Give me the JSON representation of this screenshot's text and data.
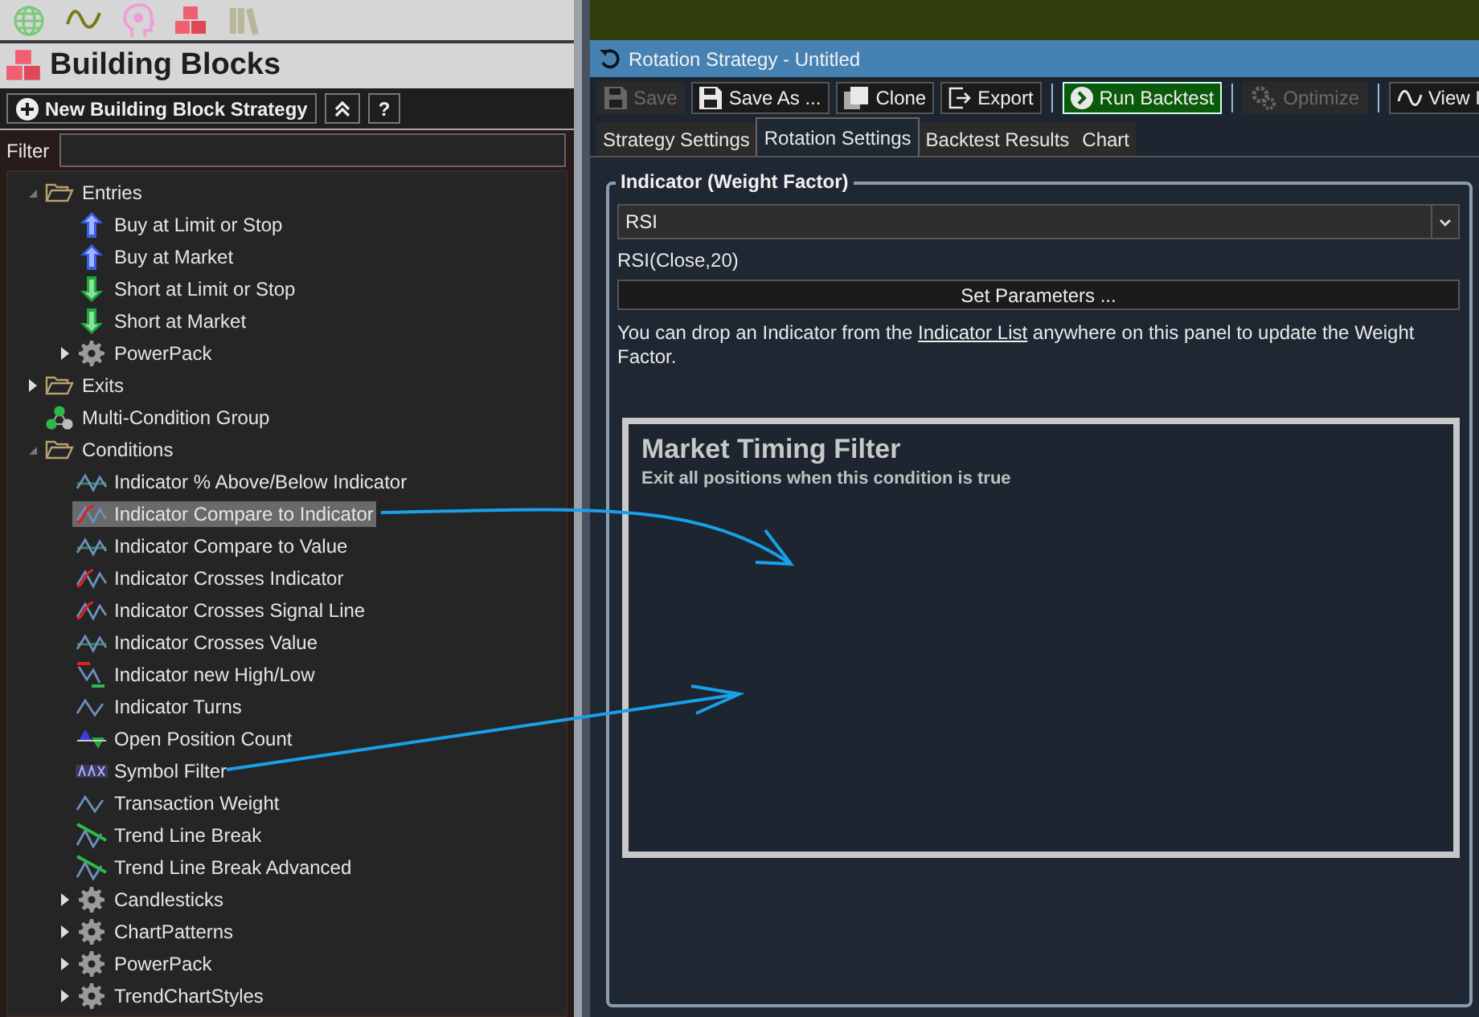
{
  "left_panel": {
    "title": "Building Blocks",
    "new_button": "New Building Block Strategy",
    "help_button": "?",
    "filter": {
      "label": "Filter"
    },
    "tree": [
      {
        "label": "Entries",
        "kind": "folder",
        "expanded": true,
        "selected": false,
        "children": [
          {
            "label": "Buy at Limit or Stop",
            "kind": "buy",
            "selected": false
          },
          {
            "label": "Buy at Market",
            "kind": "buy",
            "selected": false
          },
          {
            "label": "Short at Limit or Stop",
            "kind": "short",
            "selected": false
          },
          {
            "label": "Short at Market",
            "kind": "short",
            "selected": false
          },
          {
            "label": "PowerPack",
            "kind": "pack",
            "expanded": false,
            "selected": false
          }
        ]
      },
      {
        "label": "Exits",
        "kind": "folder",
        "expanded": false,
        "selected": false
      },
      {
        "label": "Multi-Condition Group",
        "kind": "group",
        "selected": false
      },
      {
        "label": "Conditions",
        "kind": "folder",
        "expanded": true,
        "selected": false,
        "children": [
          {
            "label": "Indicator % Above/Below Indicator",
            "kind": "wave-line",
            "selected": false
          },
          {
            "label": "Indicator Compare to Indicator",
            "kind": "wave-cross",
            "selected": true
          },
          {
            "label": "Indicator Compare to Value",
            "kind": "wave-line",
            "selected": false
          },
          {
            "label": "Indicator Crosses Indicator",
            "kind": "wave-cross",
            "selected": false
          },
          {
            "label": "Indicator Crosses Signal Line",
            "kind": "wave-cross",
            "selected": false
          },
          {
            "label": "Indicator Crosses Value",
            "kind": "wave-line",
            "selected": false
          },
          {
            "label": "Indicator new High/Low",
            "kind": "wave-highlow",
            "selected": false
          },
          {
            "label": "Indicator Turns",
            "kind": "wave",
            "selected": false
          },
          {
            "label": "Open Position Count",
            "kind": "triangles",
            "selected": false
          },
          {
            "label": "Symbol Filter",
            "kind": "symbol",
            "selected": false
          },
          {
            "label": "Transaction Weight",
            "kind": "wave",
            "selected": false
          },
          {
            "label": "Trend Line Break",
            "kind": "trend",
            "selected": false
          },
          {
            "label": "Trend Line Break Advanced",
            "kind": "trend",
            "selected": false
          },
          {
            "label": "Candlesticks",
            "kind": "pack",
            "expanded": false,
            "selected": false
          },
          {
            "label": "ChartPatterns",
            "kind": "pack",
            "expanded": false,
            "selected": false
          },
          {
            "label": "PowerPack",
            "kind": "pack",
            "expanded": false,
            "selected": false
          },
          {
            "label": "TrendChartStyles",
            "kind": "pack",
            "expanded": false,
            "selected": false
          }
        ]
      }
    ]
  },
  "window": {
    "title": "Rotation Strategy - Untitled",
    "toolbar": [
      {
        "kind": "save",
        "label": "Save",
        "disabled": true
      },
      {
        "kind": "save",
        "label": "Save As ...",
        "disabled": false
      },
      {
        "kind": "clone",
        "label": "Clone",
        "disabled": false
      },
      {
        "kind": "export",
        "label": "Export",
        "disabled": false
      },
      {
        "kind": "separator"
      },
      {
        "kind": "run",
        "label": "Run Backtest",
        "disabled": false
      },
      {
        "kind": "separator"
      },
      {
        "kind": "optimize",
        "label": "Optimize",
        "disabled": true
      },
      {
        "kind": "separator"
      },
      {
        "kind": "view",
        "label": "View I",
        "disabled": false
      }
    ],
    "tabs": [
      {
        "label": "Strategy Settings",
        "selected": false
      },
      {
        "label": "Rotation Settings",
        "selected": true
      },
      {
        "label": "Backtest Results",
        "selected": false
      },
      {
        "label": "Chart",
        "selected": false
      }
    ],
    "indicator_group": {
      "legend": "Indicator (Weight Factor)",
      "combo_value": "RSI",
      "expression": "RSI(Close,20)",
      "set_button": "Set Parameters ...",
      "note_before": "You can drop an Indicator from the",
      "note_link": "Indicator List",
      "note_after": "anywhere on this panel to update the Weight Factor."
    },
    "market_timing": {
      "title": "Market Timing Filter",
      "subtitle": "Exit all positions when this condition is true"
    }
  }
}
